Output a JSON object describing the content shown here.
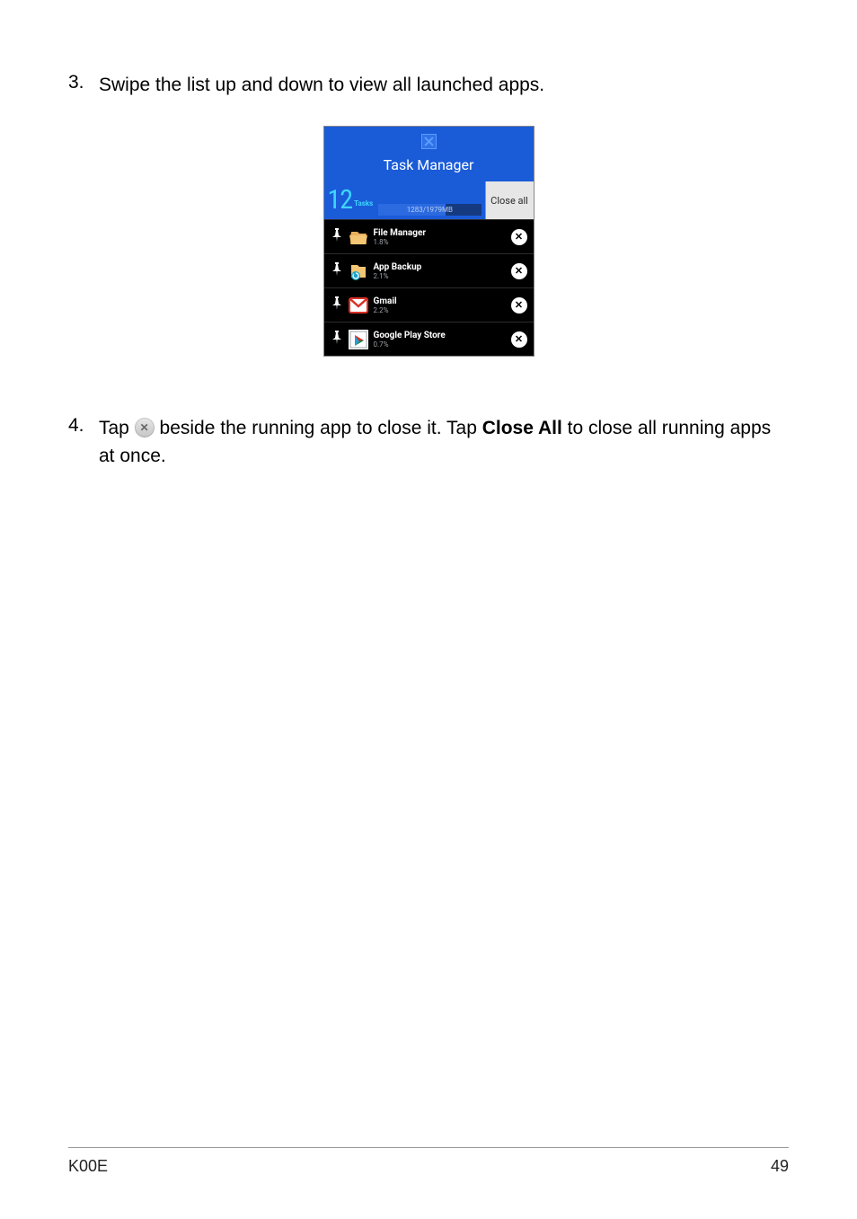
{
  "steps": {
    "s3": {
      "num": "3.",
      "text": "Swipe the list up and down to view all launched apps."
    },
    "s4": {
      "num": "4.",
      "prefix": "Tap ",
      "mid": " beside the running app to close it. Tap ",
      "bold": "Close All",
      "suffix": " to close all running apps at once."
    }
  },
  "task_manager": {
    "title": "Task Manager",
    "count": "12",
    "count_label": "Tasks",
    "memory": "1283/1979MB",
    "close_all": "Close all",
    "rows": [
      {
        "name": "File Manager",
        "pct": "1.8%"
      },
      {
        "name": "App Backup",
        "pct": "2.1%"
      },
      {
        "name": "Gmail",
        "pct": "2.2%"
      },
      {
        "name": "Google Play Store",
        "pct": "0.7%"
      }
    ]
  },
  "footer": {
    "model": "K00E",
    "page": "49"
  }
}
